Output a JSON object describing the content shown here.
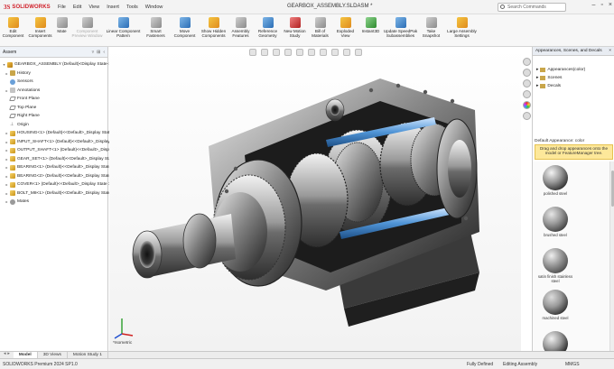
{
  "app": {
    "brand": "SOLIDWORKS",
    "document_title": "GEARBOX_ASSEMBLY.SLDASM *",
    "menus": [
      "File",
      "Edit",
      "View",
      "Insert",
      "Tools",
      "Window"
    ],
    "search_placeholder": "Search Commands"
  },
  "ribbon": [
    {
      "label1": "Edit",
      "label2": "Component",
      "icon": "y",
      "enabled": true
    },
    {
      "label1": "Insert",
      "label2": "Components",
      "icon": "y",
      "enabled": true
    },
    {
      "label1": "Mate",
      "label2": "",
      "icon": "g",
      "enabled": true
    },
    {
      "label1": "Component",
      "label2": "Preview Window",
      "icon": "g",
      "enabled": false
    },
    {
      "label1": "Linear Component",
      "label2": "Pattern",
      "icon": "b",
      "enabled": true
    },
    {
      "label1": "Smart",
      "label2": "Fasteners",
      "icon": "g",
      "enabled": true
    },
    {
      "label1": "Move",
      "label2": "Component",
      "icon": "b",
      "enabled": true
    },
    {
      "label1": "Show Hidden",
      "label2": "Components",
      "icon": "y",
      "enabled": true
    },
    {
      "label1": "Assembly",
      "label2": "Features",
      "icon": "g",
      "enabled": true
    },
    {
      "label1": "Reference",
      "label2": "Geometry",
      "icon": "b",
      "enabled": true
    },
    {
      "label1": "New Motion",
      "label2": "Study",
      "icon": "r",
      "enabled": true
    },
    {
      "label1": "Bill of",
      "label2": "Materials",
      "icon": "g",
      "enabled": true
    },
    {
      "label1": "Exploded",
      "label2": "View",
      "icon": "y",
      "enabled": true
    },
    {
      "label1": "Instant3D",
      "label2": "",
      "icon": "gr",
      "enabled": true
    },
    {
      "label1": "Update SpeedPak",
      "label2": "Subassemblies",
      "icon": "b",
      "enabled": true
    },
    {
      "label1": "Take",
      "label2": "Snapshot",
      "icon": "g",
      "enabled": true
    },
    {
      "label1": "Large Assembly",
      "label2": "Settings",
      "icon": "y",
      "enabled": true
    }
  ],
  "feature_tree": {
    "panel_title": "Assem",
    "items": [
      {
        "label": "GEARBOX_ASSEMBLY (Default)<Display State-1>",
        "icon": "asm",
        "indent": 0,
        "expander": "▾"
      },
      {
        "label": "History",
        "icon": "fold",
        "indent": 1,
        "expander": "▸"
      },
      {
        "label": "Sensors",
        "icon": "sens",
        "indent": 1,
        "expander": ""
      },
      {
        "label": "Annotations",
        "icon": "ann",
        "indent": 1,
        "expander": "▸"
      },
      {
        "label": "Front Plane",
        "icon": "plane",
        "indent": 1,
        "expander": ""
      },
      {
        "label": "Top Plane",
        "icon": "plane",
        "indent": 1,
        "expander": ""
      },
      {
        "label": "Right Plane",
        "icon": "plane",
        "indent": 1,
        "expander": ""
      },
      {
        "label": "Origin",
        "icon": "orig",
        "indent": 1,
        "expander": ""
      },
      {
        "label": "HOUSING<1> (Default)<<Default>_Display State 1>",
        "icon": "part",
        "indent": 1,
        "expander": "▸"
      },
      {
        "label": "INPUT_SHAFT<1> (Default)<<Default>_Display State 1>",
        "icon": "part",
        "indent": 1,
        "expander": "▸"
      },
      {
        "label": "OUTPUT_SHAFT<1> (Default)<<Default>_Display State 1>",
        "icon": "part",
        "indent": 1,
        "expander": "▸"
      },
      {
        "label": "GEAR_SET<1> (Default)<<Default>_Display State 1>",
        "icon": "part",
        "indent": 1,
        "expander": "▸"
      },
      {
        "label": "BEARING<1> (Default)<<Default>_Display State 1>",
        "icon": "part",
        "indent": 1,
        "expander": "▸"
      },
      {
        "label": "BEARING<2> (Default)<<Default>_Display State 1>",
        "icon": "part",
        "indent": 1,
        "expander": "▸"
      },
      {
        "label": "COVER<1> (Default)<<Default>_Display State 1>",
        "icon": "part",
        "indent": 1,
        "expander": "▸"
      },
      {
        "label": "BOLT_M8<1> (Default)<<Default>_Display State 1>",
        "icon": "part",
        "indent": 1,
        "expander": "▸"
      },
      {
        "label": "Mates",
        "icon": "mate",
        "indent": 1,
        "expander": "▸"
      }
    ]
  },
  "viewport": {
    "view_label": "*Isometric"
  },
  "appearances_panel": {
    "title": "Appearances, Scenes, and Decals",
    "tree": [
      "Appearances(color)",
      "Scenes",
      "Decals"
    ],
    "default_appearance": "Default Appearance: color",
    "hint": "Drag and drop appearances onto the model or FeatureManager tree.",
    "swatches": [
      {
        "label": "polished steel",
        "light": "#f4f4f4",
        "dark": "#3a3a3a"
      },
      {
        "label": "brushed steel",
        "light": "#e6e6e6",
        "dark": "#4a4a4a"
      },
      {
        "label": "satin finish stainless steel",
        "light": "#efefef",
        "dark": "#555555"
      },
      {
        "label": "machined steel",
        "light": "#dcdcdc",
        "dark": "#3d3d3d"
      },
      {
        "label": "",
        "light": "#f0f0f0",
        "dark": "#2f2f2f"
      }
    ]
  },
  "bottom_tabs": [
    "Model",
    "3D Views",
    "Motion Study 1"
  ],
  "status": {
    "version": "SOLIDWORKS Premium 2024 SP1.0",
    "defined": "Fully Defined",
    "mode": "Editing Assembly",
    "units": "MMGS"
  }
}
